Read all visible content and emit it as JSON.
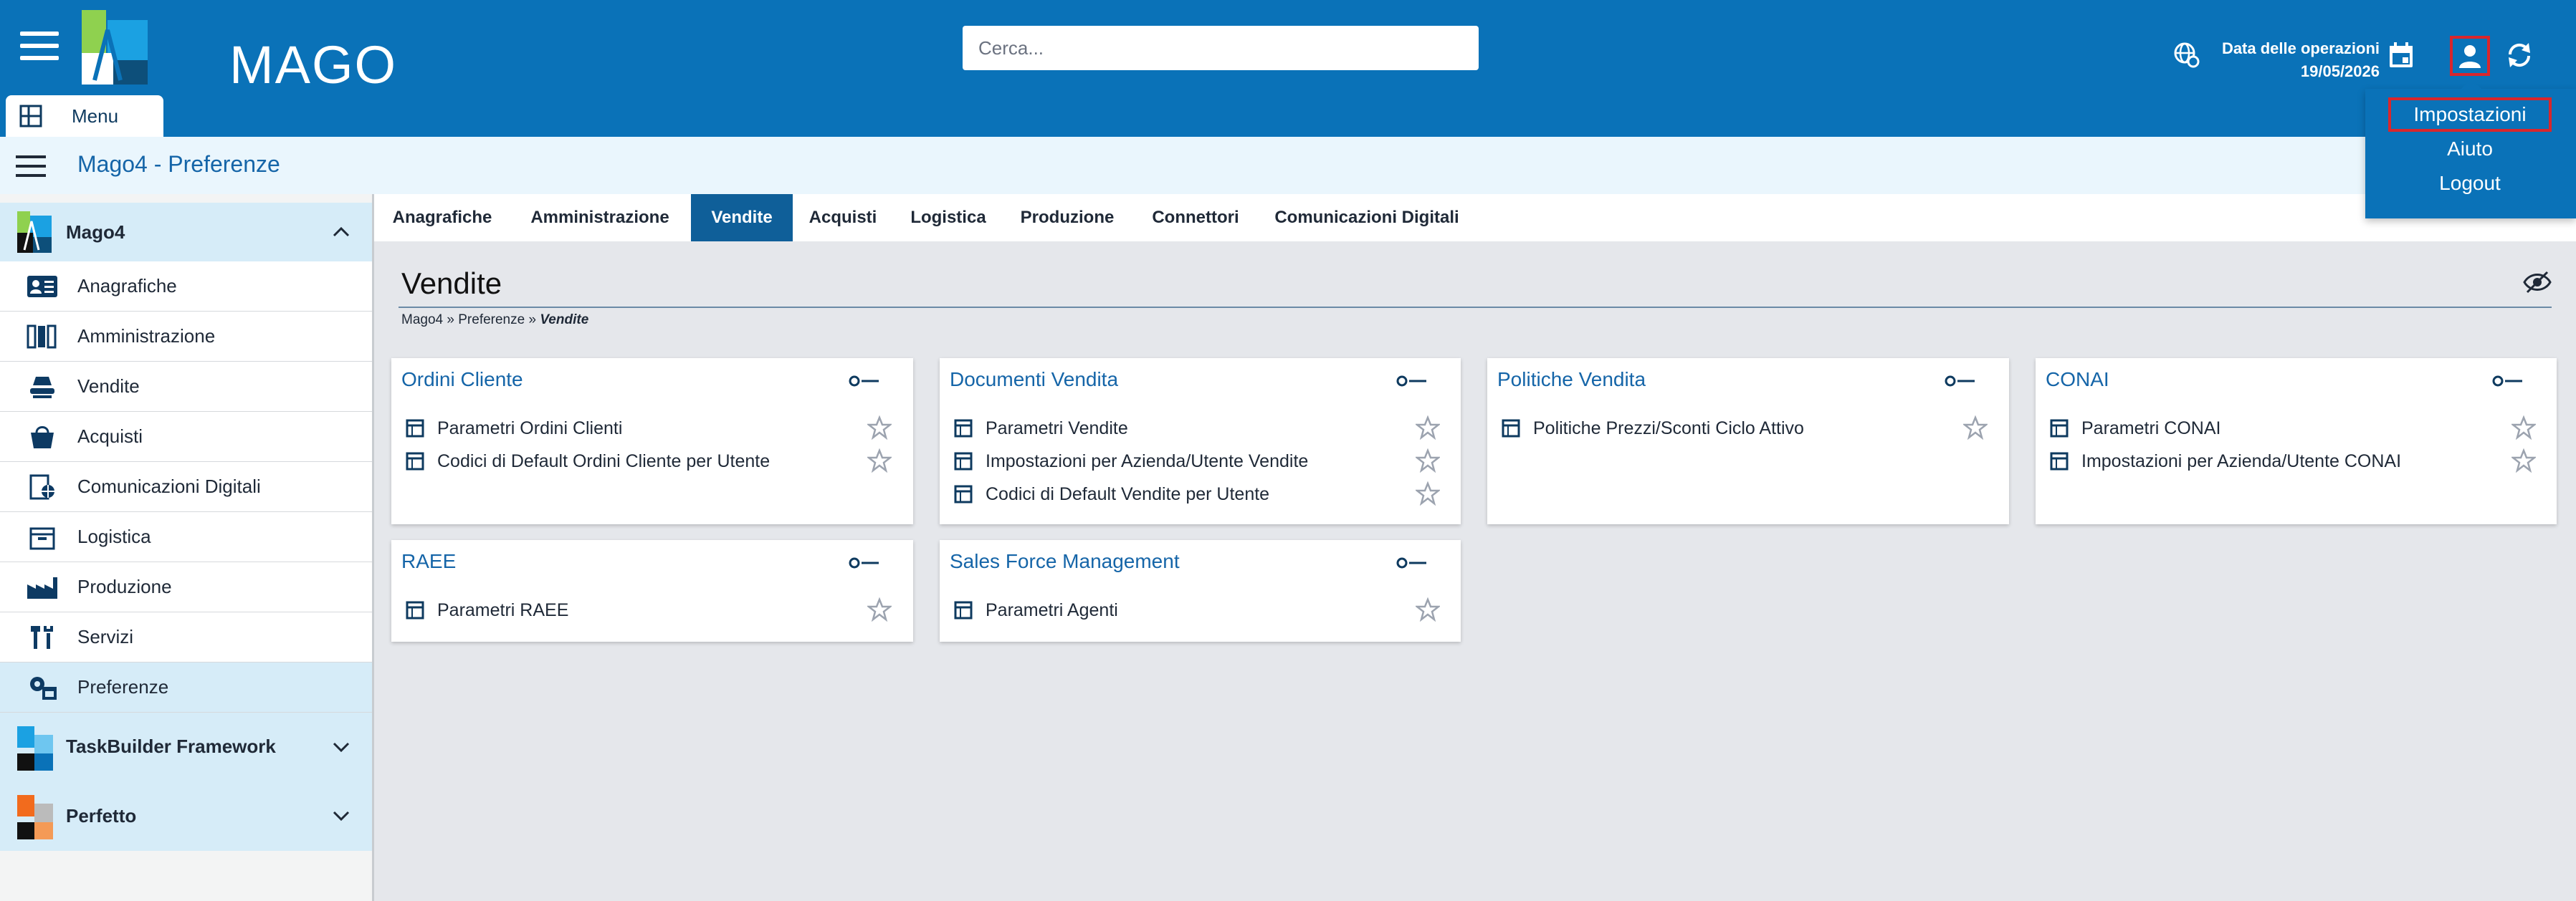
{
  "header": {
    "logo_text": "MAGO",
    "search_placeholder": "Cerca...",
    "date_label": "Data delle operazioni",
    "date_value": "19/05/2026",
    "menu_tab_label": "Menu"
  },
  "titlebar": {
    "title": "Mago4 - Preferenze"
  },
  "user_menu": {
    "items": [
      {
        "label": "Impostazioni"
      },
      {
        "label": "Aiuto"
      },
      {
        "label": "Logout"
      }
    ]
  },
  "sidebar": {
    "groups": [
      {
        "label": "Mago4"
      },
      {
        "label": "TaskBuilder Framework"
      },
      {
        "label": "Perfetto"
      }
    ],
    "items": [
      {
        "label": "Anagrafiche",
        "icon": "contact-card-icon"
      },
      {
        "label": "Amministrazione",
        "icon": "binders-icon"
      },
      {
        "label": "Vendite",
        "icon": "sales-hand-icon"
      },
      {
        "label": "Acquisti",
        "icon": "shopping-bag-icon"
      },
      {
        "label": "Comunicazioni Digitali",
        "icon": "globe-document-icon"
      },
      {
        "label": "Logistica",
        "icon": "box-icon"
      },
      {
        "label": "Produzione",
        "icon": "factory-icon"
      },
      {
        "label": "Servizi",
        "icon": "tools-icon"
      },
      {
        "label": "Preferenze",
        "icon": "gear-settings-icon"
      }
    ]
  },
  "tabs": [
    {
      "label": "Anagrafiche"
    },
    {
      "label": "Amministrazione"
    },
    {
      "label": "Vendite"
    },
    {
      "label": "Acquisti"
    },
    {
      "label": "Logistica"
    },
    {
      "label": "Produzione"
    },
    {
      "label": "Connettori"
    },
    {
      "label": "Comunicazioni Digitali"
    }
  ],
  "main": {
    "title": "Vendite",
    "breadcrumb": {
      "part1": "Mago4",
      "sep": "»",
      "part2": "Preferenze",
      "current": "Vendite"
    }
  },
  "cards": [
    {
      "title": "Ordini Cliente",
      "items": [
        "Parametri Ordini Clienti",
        "Codici di Default Ordini Cliente per Utente"
      ]
    },
    {
      "title": "Documenti Vendita",
      "items": [
        "Parametri Vendite",
        "Impostazioni per Azienda/Utente Vendite",
        "Codici di Default Vendite per Utente"
      ]
    },
    {
      "title": "Politiche Vendita",
      "items": [
        "Politiche Prezzi/Sconti Ciclo Attivo"
      ]
    },
    {
      "title": "CONAI",
      "items": [
        "Parametri CONAI",
        "Impostazioni per Azienda/Utente CONAI"
      ]
    },
    {
      "title": "RAEE",
      "items": [
        "Parametri RAEE"
      ]
    },
    {
      "title": "Sales Force Management",
      "items": [
        "Parametri Agenti"
      ]
    }
  ],
  "colors": {
    "header_blue": "#0a72b8",
    "active_tab": "#0f5f99",
    "title_blue": "#1565a8",
    "highlight_red": "#d9262c"
  }
}
